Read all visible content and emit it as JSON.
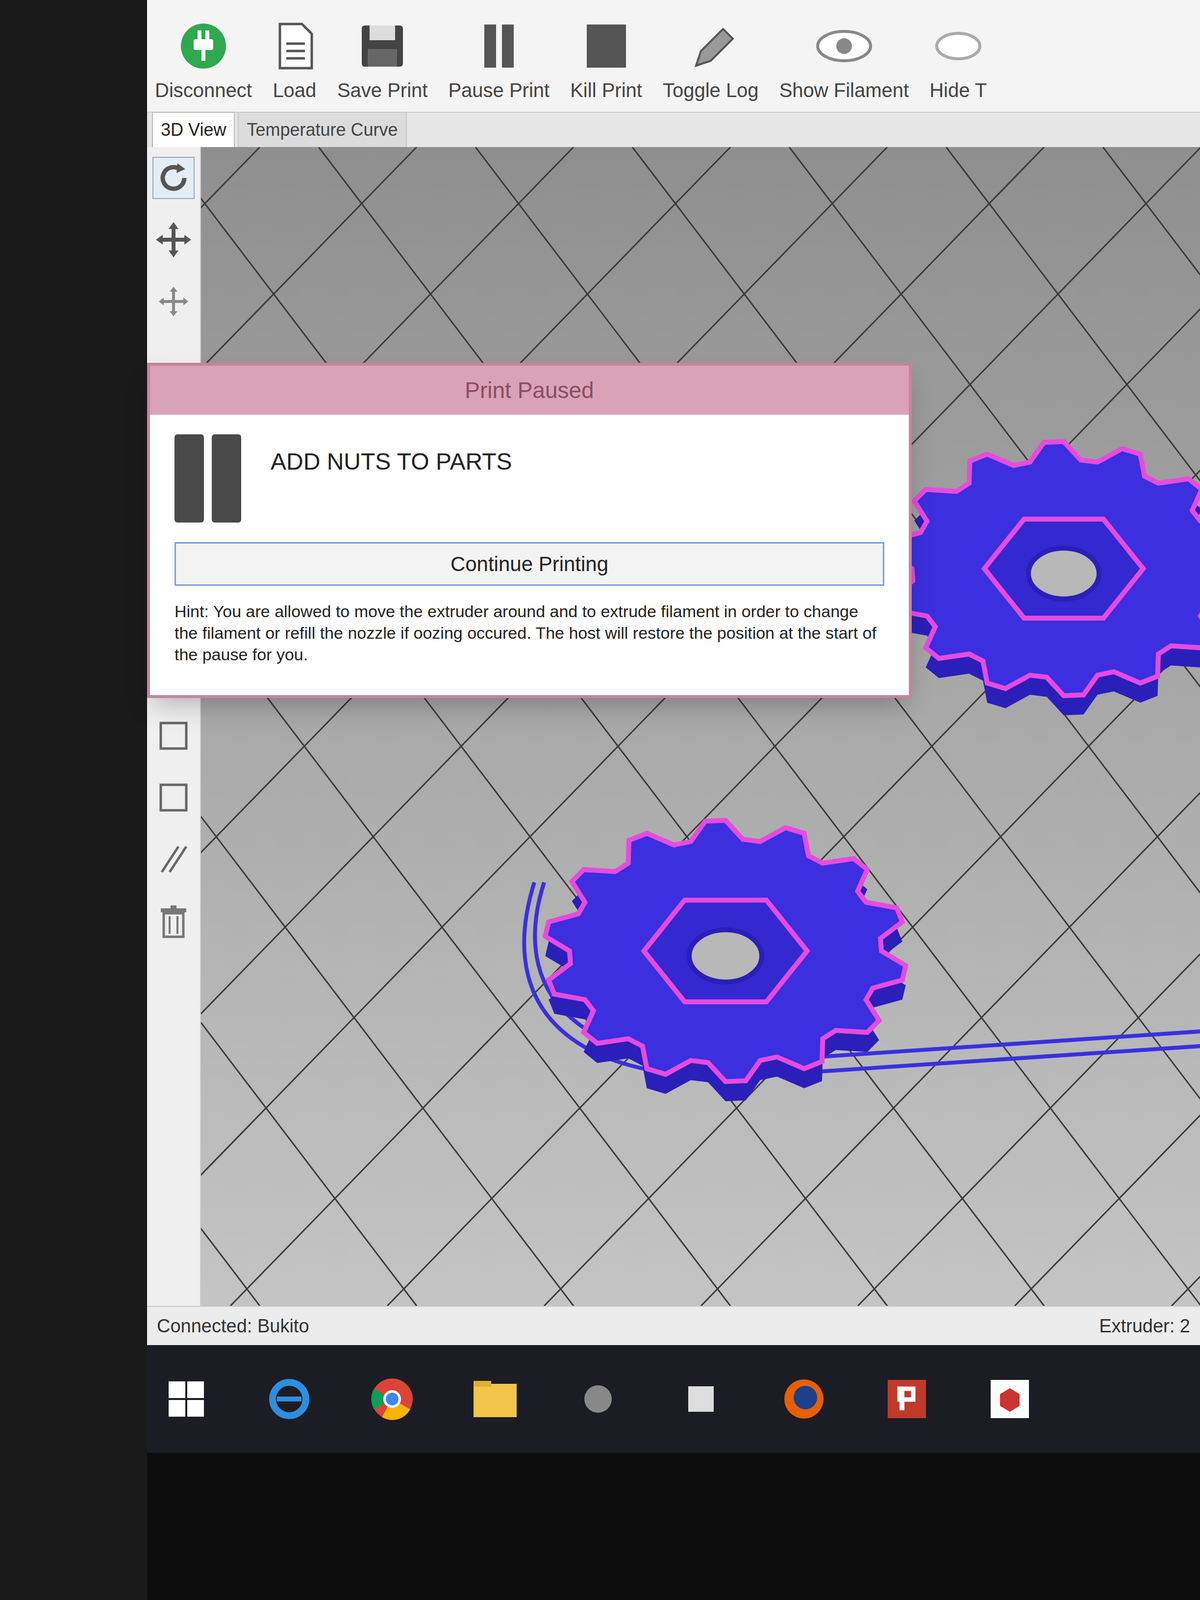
{
  "toolbar": [
    {
      "label": "Disconnect"
    },
    {
      "label": "Load"
    },
    {
      "label": "Save Print"
    },
    {
      "label": "Pause Print"
    },
    {
      "label": "Kill Print"
    },
    {
      "label": "Toggle Log"
    },
    {
      "label": "Show Filament"
    },
    {
      "label": "Hide T"
    }
  ],
  "tabs": [
    {
      "label": "3D View",
      "selected": true
    },
    {
      "label": "Temperature Curve",
      "selected": false
    }
  ],
  "dialog": {
    "title": "Print Paused",
    "message": "ADD NUTS TO PARTS",
    "button": "Continue Printing",
    "hint": "Hint: You are allowed to move the extruder around and to extrude filament in order to change the filament or refill the nozzle if oozing occured. The host will restore the position at the start of the pause for you."
  },
  "status_bar": {
    "connection": "Connected: Bukito",
    "extruder": "Extruder: 2"
  }
}
